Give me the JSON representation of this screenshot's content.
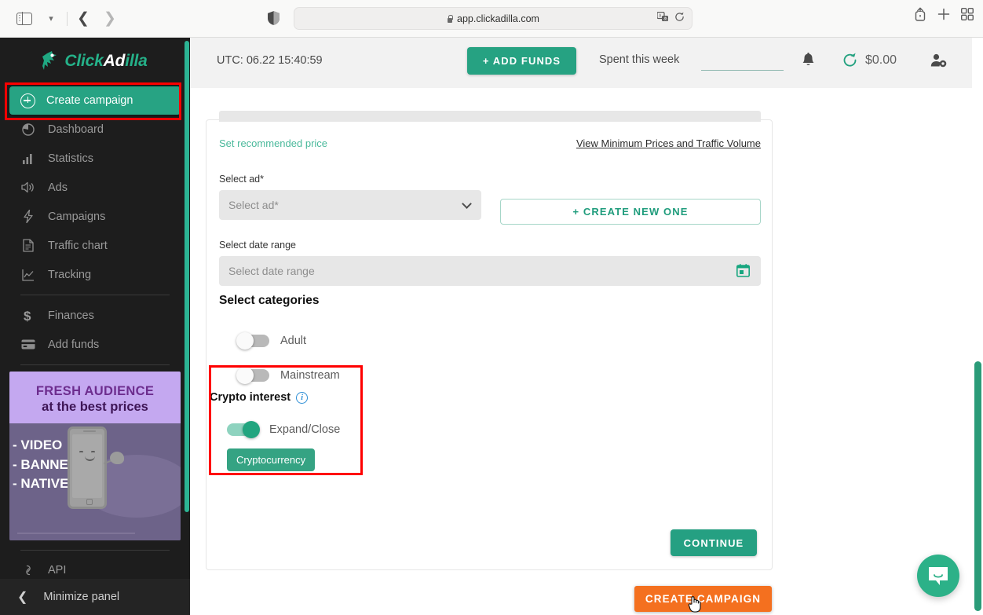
{
  "browser": {
    "url": "app.clickadilla.com",
    "icons": {
      "sidebar_toggle": "sidebar-toggle-icon",
      "tab_dropdown": "chevron-down-icon",
      "back": "‹",
      "forward": "›",
      "shield": "shield-icon",
      "lock": "lock-icon",
      "translate": "translate-icon",
      "reload": "reload-icon",
      "share": "share-icon",
      "new_tab": "+",
      "tab_overview": "tab-overview-icon"
    }
  },
  "sidebar": {
    "logo": {
      "part1": "Click",
      "part2": "Ad",
      "part3": "illa"
    },
    "create_campaign": {
      "label": "Create campaign",
      "icon": "plus-circle-icon"
    },
    "items": [
      {
        "label": "Dashboard",
        "icon": "pie-chart-icon"
      },
      {
        "label": "Statistics",
        "icon": "bar-chart-icon"
      },
      {
        "label": "Ads",
        "icon": "speaker-icon"
      },
      {
        "label": "Campaigns",
        "icon": "lightning-icon"
      },
      {
        "label": "Traffic chart",
        "icon": "document-icon"
      },
      {
        "label": "Tracking",
        "icon": "line-chart-icon"
      },
      {
        "label": "Finances",
        "icon": "dollar-icon"
      },
      {
        "label": "Add funds",
        "icon": "credit-card-icon"
      }
    ],
    "promo": {
      "line1": "FRESH AUDIENCE",
      "line2": "at the best prices",
      "bullets": "- VIDEO\n- BANNER\n- NATIVE"
    },
    "api": {
      "label": "API",
      "icon": "link-icon"
    },
    "minimize": {
      "label": "Minimize panel",
      "icon": "chevron-left-icon"
    }
  },
  "topbar": {
    "utc": "UTC: 06.22 15:40:59",
    "add_funds": "+ ADD FUNDS",
    "spent_label": "Spent this week",
    "spent_value": "",
    "balance": "$0.00",
    "icons": {
      "bell": "bell-icon",
      "refresh": "refresh-icon",
      "account": "user-settings-icon"
    }
  },
  "form": {
    "set_recommended_price": "Set recommended price",
    "view_min_prices": "View Minimum Prices and Traffic Volume",
    "select_ad": {
      "label": "Select ad*",
      "placeholder": "Select ad*",
      "value": ""
    },
    "create_new_one": "+  CREATE NEW ONE",
    "date_range": {
      "label": "Select date range",
      "placeholder": "Select date range",
      "value": ""
    },
    "categories_title": "Select categories",
    "toggles": [
      {
        "label": "Adult",
        "on": false
      },
      {
        "label": "Mainstream",
        "on": false
      }
    ],
    "crypto": {
      "title": "Crypto interest",
      "info_icon": "info-icon",
      "toggle_label": "Expand/Close",
      "toggle_on": true,
      "chip": "Cryptocurrency"
    },
    "continue": "CONTINUE",
    "create_campaign": "CREATE CAMPAIGN"
  },
  "colors": {
    "brand_green": "#27a383",
    "accent_orange": "#f4701f",
    "sidebar_bg": "#1d1d1d",
    "highlight_red": "#ff0000"
  }
}
